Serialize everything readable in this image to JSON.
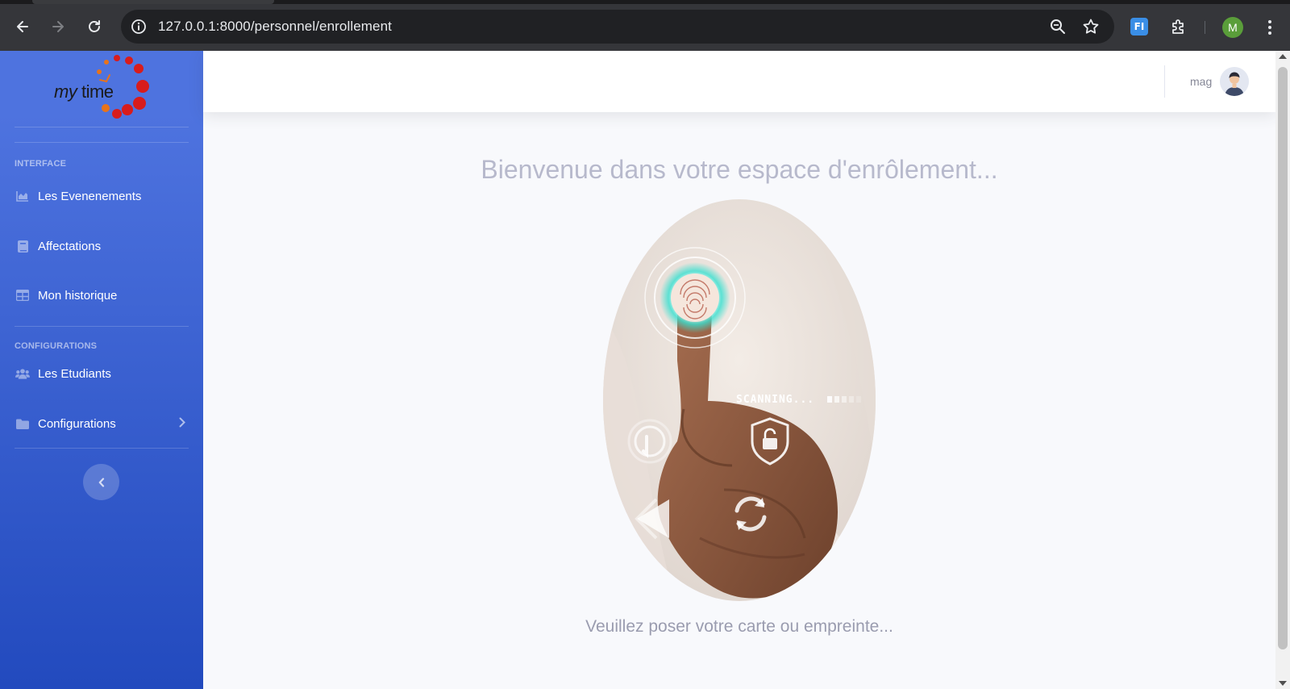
{
  "browser": {
    "url": "127.0.0.1:8000/personnel/enrollement",
    "profile_initial": "M",
    "extension_label": "FI"
  },
  "brand": {
    "name_italic": "my",
    "name_rest": "time"
  },
  "sidebar": {
    "sections": [
      {
        "heading": "INTERFACE"
      },
      {
        "heading": "CONFIGURATIONS"
      }
    ],
    "items": [
      {
        "label": "Les Evenenements",
        "icon": "chart-area-icon"
      },
      {
        "label": "Affectations",
        "icon": "book-icon"
      },
      {
        "label": "Mon historique",
        "icon": "table-icon"
      },
      {
        "label": "Les Etudiants",
        "icon": "users-icon"
      },
      {
        "label": "Configurations",
        "icon": "folder-icon"
      }
    ]
  },
  "topbar": {
    "username": "mag"
  },
  "main": {
    "welcome": "Bienvenue dans votre espace d'enrôlement...",
    "scan_overlay_text": "SCANNING...",
    "prompt": "Veuillez poser votre carte ou empreinte..."
  },
  "colors": {
    "sidebar_top": "#4e73df",
    "sidebar_bottom": "#224abe",
    "page_bg": "#f8f9fc",
    "scan_glow": "#38e0d0"
  }
}
